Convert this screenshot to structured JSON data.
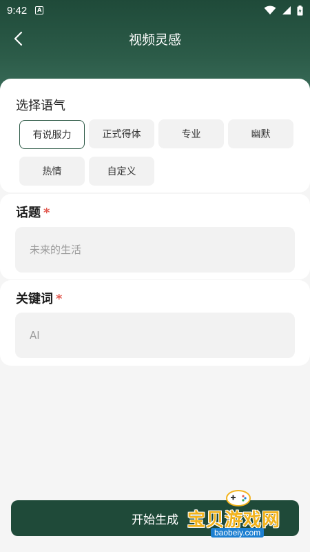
{
  "status_bar": {
    "time": "9:42",
    "notification_icon": "a-notification-icon",
    "icons": [
      "wifi-icon",
      "signal-icon",
      "battery-icon"
    ]
  },
  "header": {
    "title": "视频灵感",
    "back_icon": "chevron-left-icon"
  },
  "tone_section": {
    "title": "选择语气",
    "options": [
      {
        "label": "有说服力",
        "selected": true
      },
      {
        "label": "正式得体",
        "selected": false
      },
      {
        "label": "专业",
        "selected": false
      },
      {
        "label": "幽默",
        "selected": false
      },
      {
        "label": "热情",
        "selected": false
      },
      {
        "label": "自定义",
        "selected": false
      }
    ]
  },
  "topic_section": {
    "title": "话题",
    "required_mark": "*",
    "placeholder": "未来的生活",
    "value": ""
  },
  "keyword_section": {
    "title": "关键词",
    "required_mark": "*",
    "placeholder": "AI",
    "value": ""
  },
  "actions": {
    "generate_label": "开始生成"
  },
  "watermark": {
    "text": "宝贝游戏网",
    "url": "baobeiy.com"
  },
  "colors": {
    "primary": "#1f4a39",
    "required": "#e25b52",
    "chip_bg": "#f2f2f2",
    "watermark_text": "#f2b21b"
  }
}
